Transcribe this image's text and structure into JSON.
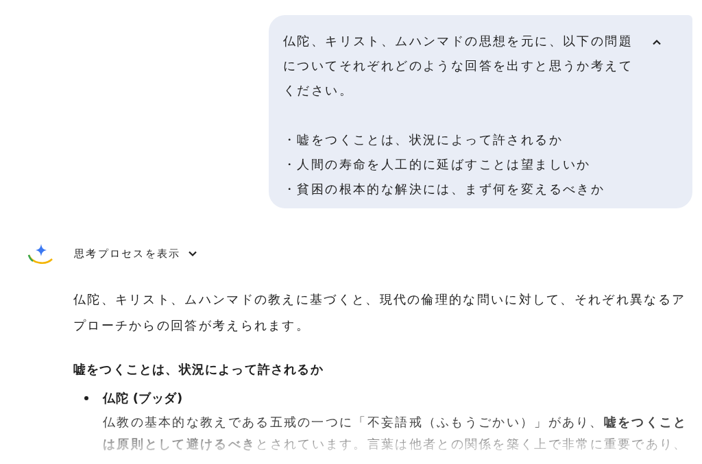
{
  "prompt": {
    "paragraph": "仏陀、キリスト、ムハンマドの思想を元に、以下の問題についてそれぞれどのような回答を出すと思うか考えてください。",
    "items": [
      "・嘘をつくことは、状況によって許されるか",
      "・人間の寿命を人工的に延ばすことは望ましいか",
      "・貧困の根本的な解決には、まず何を変えるべきか"
    ],
    "expanded": true
  },
  "thinking": {
    "label": "思考プロセスを表示",
    "expanded": false
  },
  "response": {
    "intro": "仏陀、キリスト、ムハンマドの教えに基づくと、現代の倫理的な問いに対して、それぞれ異なるアプローチからの回答が考えられます。",
    "heading": "嘘をつくことは、状況によって許されるか",
    "bullets": [
      {
        "title": "仏陀 (ブッダ)",
        "text": "仏教の基本的な教えである五戒の一つに「不妄語戒（ふもうごかい）」があり、**嘘をつくことは原則として避けるべき**とされています。言葉は他者との関係を築く上で非常に重要であり、"
      }
    ]
  }
}
